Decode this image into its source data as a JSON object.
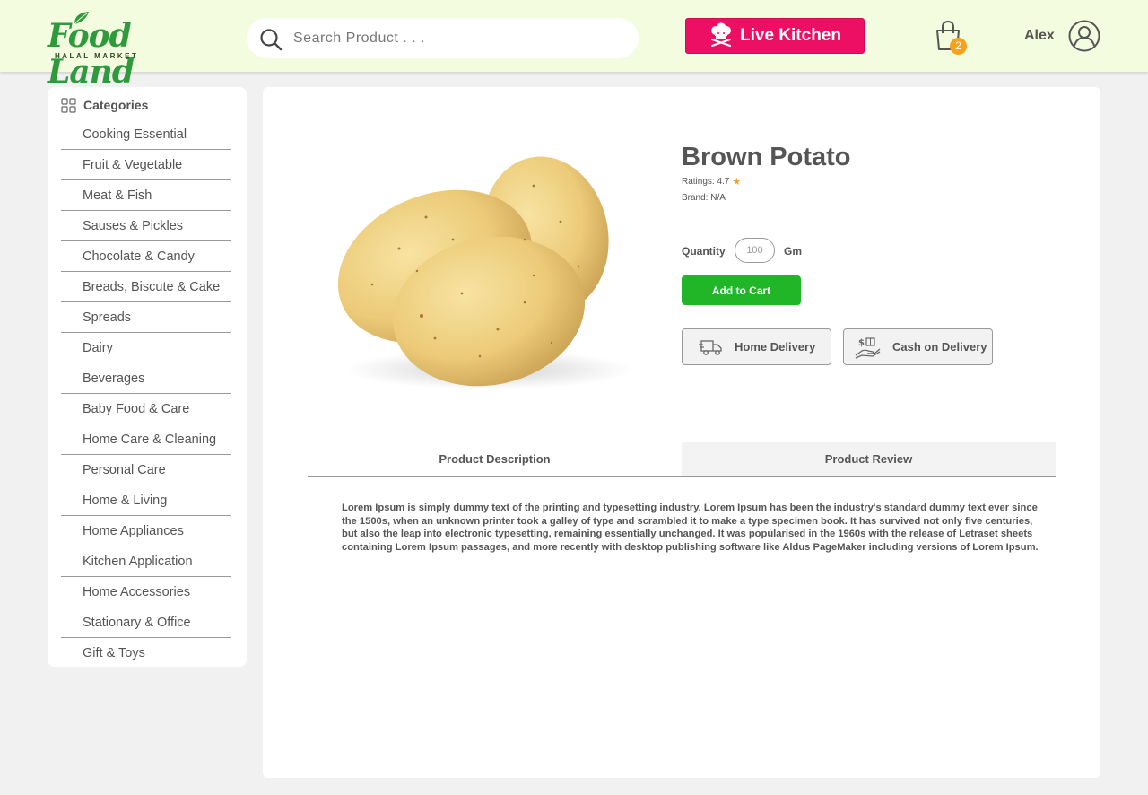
{
  "header": {
    "logo_main": "Food Land",
    "logo_sub": "HALAL MARKET",
    "search_placeholder": "Search Product . . .",
    "live_kitchen_label": "Live Kitchen",
    "cart_count": "2",
    "user_name": "Alex",
    "colors": {
      "header_bg": "#f4fcdf",
      "live_button": "#ec0f64",
      "badge": "#f7a21a"
    }
  },
  "sidebar": {
    "heading": "Categories",
    "items": [
      "Cooking Essential",
      "Fruit & Vegetable",
      "Meat & Fish",
      "Sauses & Pickles",
      "Chocolate & Candy",
      "Breads, Biscute & Cake",
      "Spreads",
      "Dairy",
      "Beverages",
      "Baby Food & Care",
      "Home Care & Cleaning",
      "Personal Care",
      "Home & Living",
      "Home Appliances",
      "Kitchen Application",
      "Home Accessories",
      "Stationary & Office",
      "Gift & Toys"
    ]
  },
  "product": {
    "title": "Brown Potato",
    "ratings_label": "Ratings: 4.7",
    "brand_label": "Brand: N/A",
    "quantity_label": "Quantity",
    "quantity_value": "100",
    "quantity_unit": "Gm",
    "add_to_cart_label": "Add to Cart",
    "home_delivery_label": "Home Delivery",
    "cash_on_delivery_label": "Cash on Delivery",
    "colors": {
      "add_to_cart": "#21b628",
      "star": "#f7a21a"
    }
  },
  "tabs": {
    "description_label": "Product Description",
    "review_label": "Product Review",
    "active": "Product Description"
  },
  "description": "Lorem Ipsum is simply dummy text of the printing and typesetting industry. Lorem Ipsum has been the industry's standard dummy text ever since the 1500s, when an unknown printer took a galley of type and scrambled it to make a type specimen book. It has survived not only five centuries, but also the leap into electronic typesetting, remaining essentially unchanged. It was popularised in the 1960s with the release of Letraset sheets containing Lorem Ipsum passages, and more recently with desktop publishing software like Aldus PageMaker including versions of Lorem Ipsum."
}
